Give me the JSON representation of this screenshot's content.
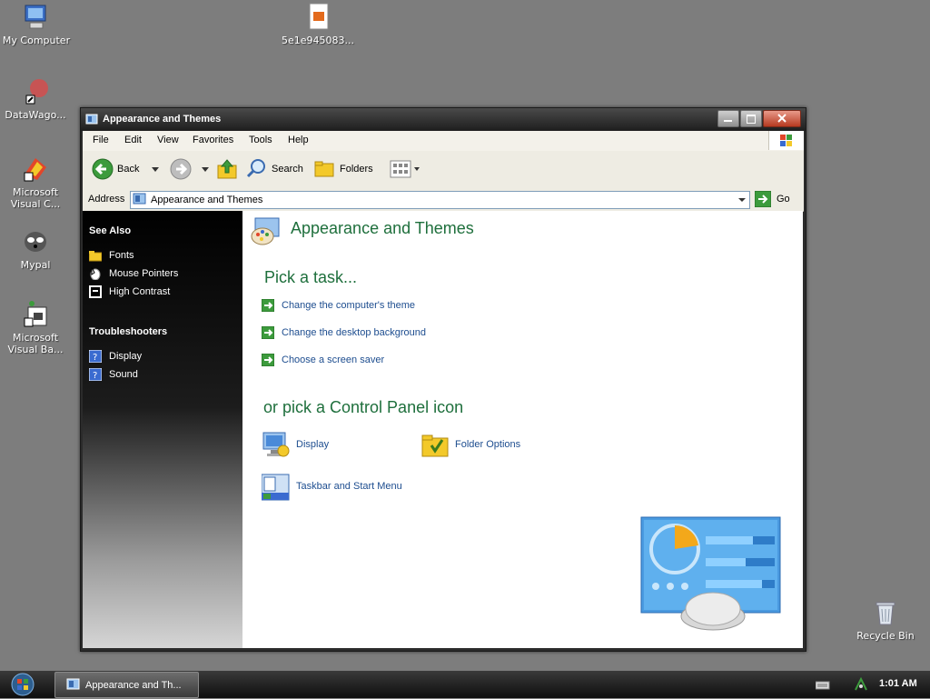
{
  "desktop": {
    "icons": [
      {
        "label": "My Computer",
        "icon": "computer-icon"
      },
      {
        "label": "5e1e945083...",
        "icon": "file-icon"
      },
      {
        "label": "DataWago...",
        "icon": "shortcut-icon"
      },
      {
        "label": "Microsoft Visual C...",
        "icon": "shortcut-icon"
      },
      {
        "label": "Mypal",
        "icon": "browser-icon"
      },
      {
        "label": "Microsoft Visual Ba...",
        "icon": "shortcut-icon"
      },
      {
        "label": "Recycle Bin",
        "icon": "recycle-bin-icon"
      }
    ]
  },
  "window": {
    "title": "Appearance and Themes",
    "menu": [
      "File",
      "Edit",
      "View",
      "Favorites",
      "Tools",
      "Help"
    ],
    "toolbar": {
      "back": "Back",
      "search": "Search",
      "folders": "Folders"
    },
    "address": {
      "label": "Address",
      "value": "Appearance and Themes",
      "go": "Go"
    },
    "side": {
      "see_also_title": "See Also",
      "see_also": [
        {
          "label": "Fonts",
          "icon": "folder-icon"
        },
        {
          "label": "Mouse Pointers",
          "icon": "mouse-icon"
        },
        {
          "label": "High Contrast",
          "icon": "contrast-icon"
        }
      ],
      "troubleshooters_title": "Troubleshooters",
      "troubleshooters": [
        {
          "label": "Display",
          "icon": "help-icon"
        },
        {
          "label": "Sound",
          "icon": "help-icon"
        }
      ]
    },
    "content": {
      "title": "Appearance and Themes",
      "pick_task": "Pick a task...",
      "tasks": [
        "Change the computer's theme",
        "Change the desktop background",
        "Choose a screen saver"
      ],
      "pick_icon": "or pick a Control Panel icon",
      "icons": [
        {
          "label": "Display",
          "icon": "display-icon"
        },
        {
          "label": "Folder Options",
          "icon": "folder-options-icon"
        },
        {
          "label": "Taskbar and Start Menu",
          "icon": "taskbar-icon"
        }
      ]
    }
  },
  "taskbar": {
    "app_label": "Appearance and Th...",
    "clock": "1:01 AM"
  },
  "colors": {
    "desktop": "#7d7d7d",
    "heading_green": "#1e6f3c",
    "link_blue": "#1d4d8f"
  }
}
